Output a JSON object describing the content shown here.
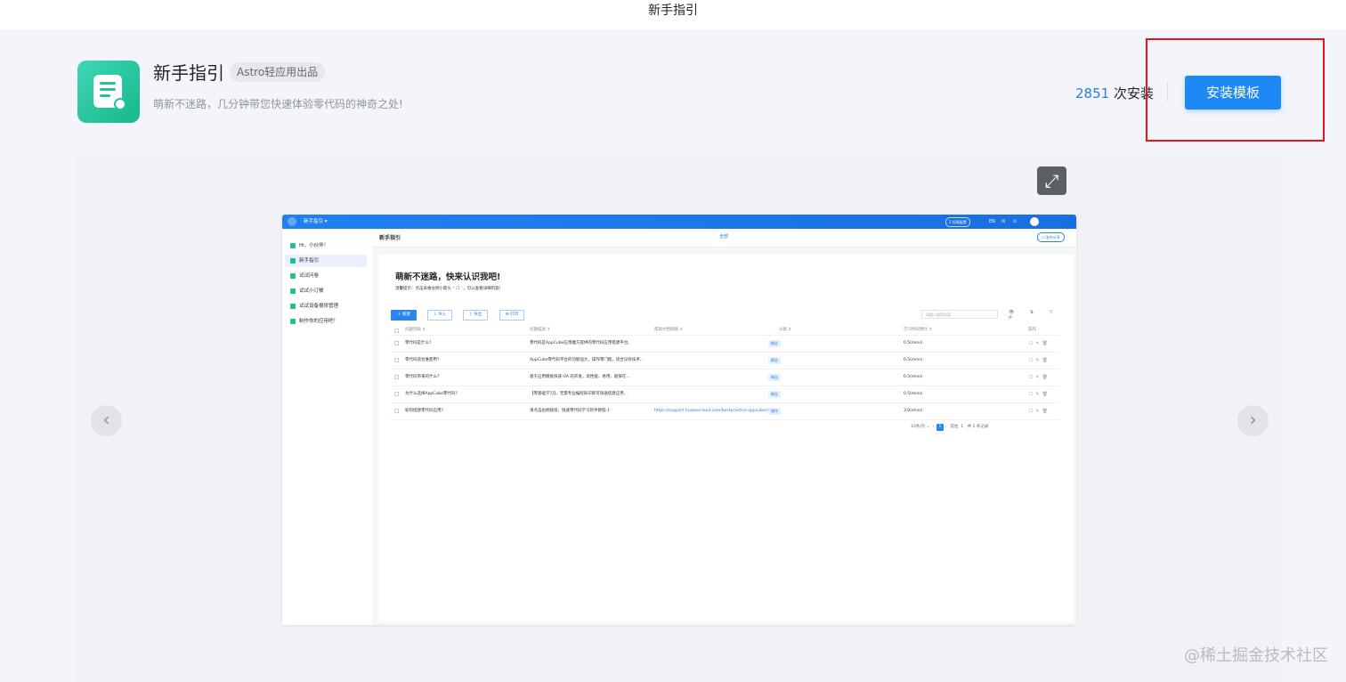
{
  "window": {
    "title": "新手指引"
  },
  "app": {
    "name": "新手指引",
    "tag": "Astro轻应用出品",
    "description": "萌新不迷路，几分钟带您快速体验零代码的神奇之处!",
    "install_count": "2851",
    "install_suffix": " 次安装",
    "install_button": "安装模板",
    "accent_color": "#1e88f5",
    "highlight_color": "#e8141b"
  },
  "preview": {
    "expand_icon": "expand-arrows-icon",
    "prev_icon": "chevron-left-icon",
    "next_icon": "chevron-right-icon",
    "prev_glyph": "‹",
    "next_glyph": "›",
    "expand_glyph": "⤢",
    "shot": {
      "app_name": "新手指引 ▾",
      "header_right": [
        "2 权限配置",
        "EN",
        "✉",
        "⊙"
      ],
      "sidebar": [
        "Hi，小伙伴！",
        "新手指引",
        "试试问卷",
        "试试小订餐",
        "试试设备报修管理",
        "制作你的应用吧！"
      ],
      "page_title": "新手指引",
      "center_link": "全部",
      "share_button": "☐ 发布分享",
      "welcome": "萌新不迷路，快来认识我吧!",
      "hint": "温馨提示：点击表格左侧小箭头 ⁺ ☐ ⁻，可以查看详细内容!",
      "toolbar": [
        "＋ 新建",
        "⇩ 导入",
        "⇧ 导出",
        "⊞ 打印"
      ],
      "search_placeholder": "请输入搜索内容",
      "tools": "👁 ⇅ ▽ ⟳",
      "columns": [
        "问题列表 ↕",
        "问题描述 ↕",
        "帮助文档链接 ↕",
        "分类 ↕",
        "学习时间预计 ↕",
        "操作"
      ],
      "rows": [
        {
          "q": "零代码是什么?",
          "desc": "零代码是AppCube应用魔方提供的零代码应用搭建平台,",
          "link": "",
          "cat": "概念",
          "time": "0.5(mins)"
        },
        {
          "q": "零代码适合谁使用?",
          "desc": "AppCube零代码平台的功能强大，操作零门槛，适合没有技术...",
          "link": "",
          "cat": "概念",
          "time": "0.5(mins)"
        },
        {
          "q": "零代码带来的什么?",
          "desc": "基于应用模板快速 OA 的开发，高性能、易用、能够在...",
          "link": "",
          "cat": "概念",
          "time": "0.5(mins)"
        },
        {
          "q": "为什么选择AppCube零代码?",
          "desc": "【零基础学习】，无需专业编程知识即可快速搭建应用...",
          "link": "",
          "cat": "概念",
          "time": "0.5(mins)"
        },
        {
          "q": "如何搭建零代码应用?",
          "desc": "请点击右侧链接，快速零代码学习新手教程-1",
          "link": "https://support.huaweicloud.com/bestpractice-appcube/appcube...",
          "cat": "操作",
          "time": "3.0(mins)"
        }
      ],
      "row_actions": "☐✎🗑",
      "pager": {
        "size": "10条/页 ⌄",
        "current": "1",
        "goto": "前往",
        "goto_page": "1",
        "total": "共 5 条记录"
      }
    }
  },
  "watermark": "@稀土掘金技术社区"
}
